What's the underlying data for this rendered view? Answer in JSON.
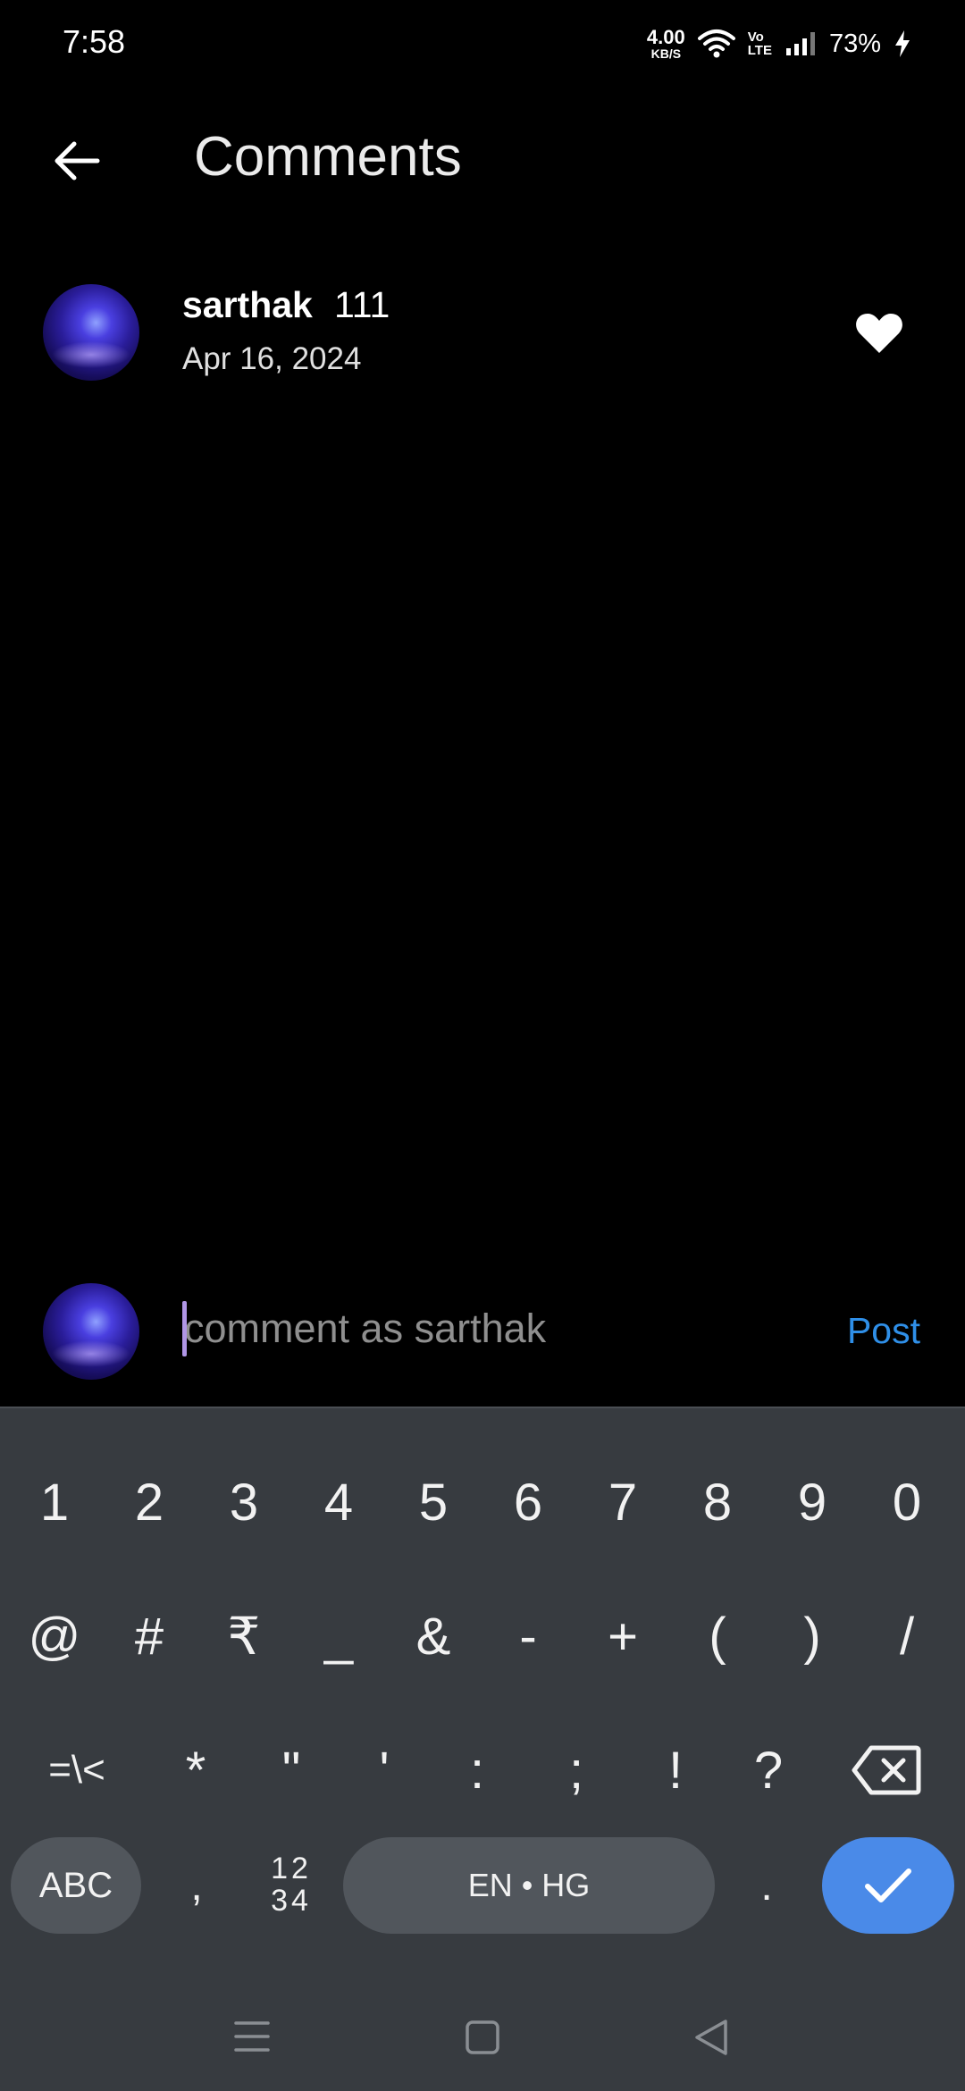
{
  "status_bar": {
    "time": "7:58",
    "net_speed_value": "4.00",
    "net_speed_unit": "KB/S",
    "volte_top": "Vo",
    "volte_bottom": "LTE",
    "battery": "73%"
  },
  "header": {
    "title": "Comments",
    "back_icon": "arrow-left-icon"
  },
  "comments": [
    {
      "username": "sarthak",
      "text": "111",
      "date": "Apr 16, 2024",
      "liked": true
    }
  ],
  "composer": {
    "placeholder": "comment as sarthak",
    "value": "",
    "post_label": "Post"
  },
  "keyboard": {
    "row1": [
      "1",
      "2",
      "3",
      "4",
      "5",
      "6",
      "7",
      "8",
      "9",
      "0"
    ],
    "row2": [
      "@",
      "#",
      "₹",
      "_",
      "&",
      "-",
      "+",
      "(",
      ")",
      "/"
    ],
    "row3": [
      "=\\<",
      "*",
      "\"",
      "'",
      ":",
      ";",
      "!",
      "?"
    ],
    "abc_label": "ABC",
    "comma": ",",
    "numpad_top": "12",
    "numpad_bottom": "34",
    "space_label": "EN • HG",
    "period": ".",
    "backspace_icon": "backspace-icon",
    "enter_icon": "checkmark-icon"
  },
  "nav_bar": {
    "items": [
      "menu-icon",
      "home-icon",
      "back-icon"
    ]
  },
  "colors": {
    "background": "#000000",
    "accent_link": "#2f8fe8",
    "keyboard_bg": "#373b40",
    "enter_key": "#4a8ae8"
  }
}
